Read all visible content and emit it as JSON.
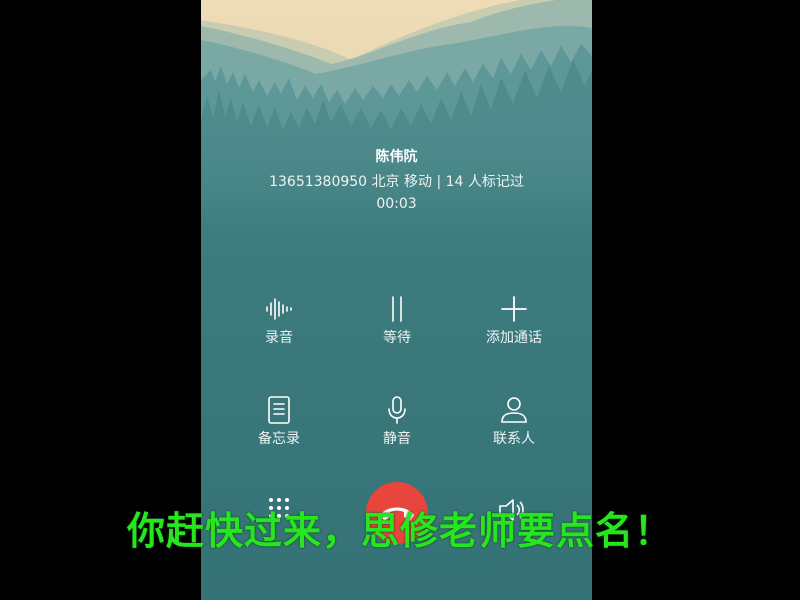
{
  "call": {
    "name": "陈伟阬",
    "number_info": "13651380950  北京 移动   | 14 人标记过",
    "timer": "00:03"
  },
  "controls": {
    "record": {
      "label": "录音",
      "icon": "waveform-icon"
    },
    "hold": {
      "label": "等待",
      "icon": "pause-icon"
    },
    "add_call": {
      "label": "添加通话",
      "icon": "plus-icon"
    },
    "memo": {
      "label": "备忘录",
      "icon": "document-icon"
    },
    "mute": {
      "label": "静音",
      "icon": "microphone-icon"
    },
    "contacts": {
      "label": "联系人",
      "icon": "person-icon"
    }
  },
  "bottom": {
    "dialpad_icon": "dialpad-icon",
    "end_call_icon": "end-call-icon",
    "end_call_color": "#e8453c",
    "speaker_icon": "speaker-icon"
  },
  "subtitle": {
    "text": "你赶快过来，思修老师要点名！",
    "color": "#27e620"
  }
}
